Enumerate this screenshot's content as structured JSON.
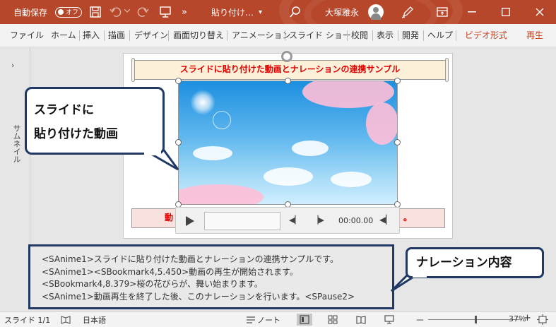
{
  "titlebar": {
    "autosave_label": "自動保存",
    "autosave_state": "オフ",
    "more": "»",
    "filename": "貼り付け…",
    "dropdown": "▾",
    "user_name": "大塚雅永"
  },
  "ribbon": {
    "tabs": [
      "ファイル",
      "ホーム",
      "挿入",
      "描画",
      "デザイン",
      "画面切り替え",
      "アニメーション",
      "スライド ショー",
      "校閲",
      "表示",
      "開発",
      "ヘルプ",
      "ビデオ形式",
      "再生"
    ],
    "accent_color": "#c43e1c"
  },
  "sidebar": {
    "expand": "›",
    "label": "サムネイル"
  },
  "slide": {
    "title": "スライドに貼り付けた動画とナレーションの連携サンプル",
    "bottom_left": "動",
    "bottom_right": "。"
  },
  "video_controls": {
    "time": "00:00.00"
  },
  "callout1": {
    "line1": "スライドに",
    "line2": "貼り付けた動画"
  },
  "callout2": {
    "text": "ナレーション内容"
  },
  "notes": {
    "lines": [
      "<SAnime1>スライドに貼り付けた動画とナレーションの連携サンプルです。",
      "<SAnime1><SBookmark4,5.450>動画の再生が開始されます。",
      "<SBookmark4,8.379>桜の花びらが、舞い始まります。",
      "<SAnime1>動画再生を終了した後、このナレーションを行います。<SPause2>"
    ]
  },
  "status": {
    "slide": "スライド 1/1",
    "language": "日本語",
    "notes": "ノート",
    "minus": "－",
    "plus": "+",
    "zoom": "37%"
  },
  "colors": {
    "titlebar": "#b7472a",
    "callout_border": "#1f3864",
    "title_text": "#e00000"
  }
}
